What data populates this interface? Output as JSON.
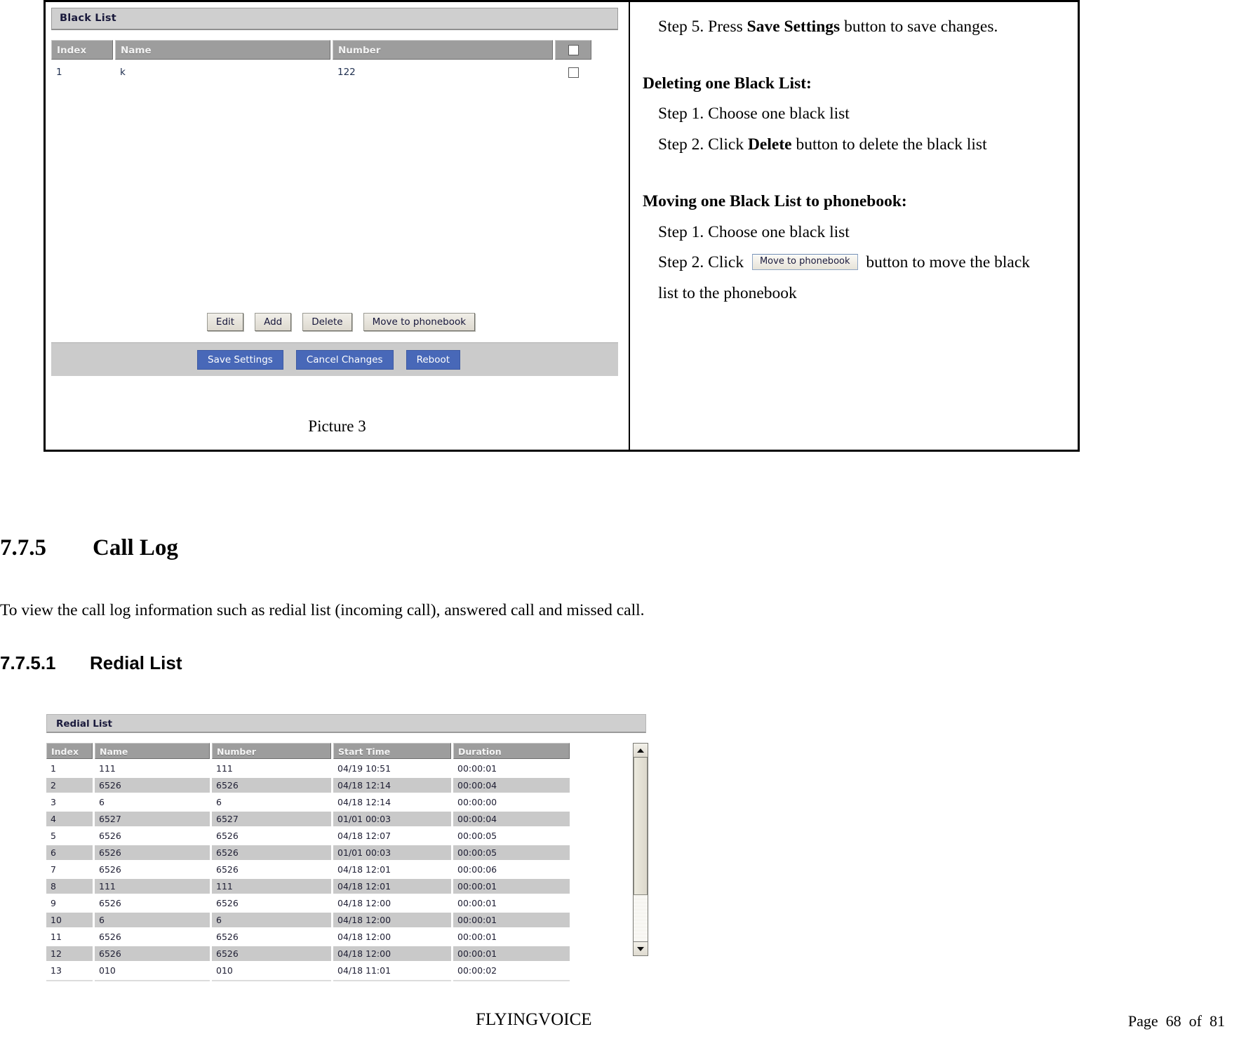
{
  "figure": {
    "caption": "Picture 3",
    "blacklist_panel": {
      "title": "Black List",
      "columns": [
        "Index",
        "Name",
        "Number"
      ],
      "select_all_checkbox": "select-all",
      "rows": [
        {
          "index": "1",
          "name": "k",
          "number": "122",
          "checked": false
        }
      ],
      "row_buttons": [
        "Edit",
        "Add",
        "Delete",
        "Move to phonebook"
      ],
      "footer_buttons": [
        "Save Settings",
        "Cancel Changes",
        "Reboot"
      ]
    },
    "instructions": {
      "step5_prefix": "Step 5. Press ",
      "step5_bold": "Save Settings",
      "step5_suffix": " button to save changes.",
      "delete_heading": "Deleting one Black List:",
      "delete_step1": "Step 1. Choose one black list",
      "delete_step2_prefix": "Step 2. Click ",
      "delete_step2_bold": "Delete",
      "delete_step2_suffix": " button to delete the black list",
      "move_heading": "Moving one Black List to phonebook:",
      "move_step1": "Step 1. Choose one black list",
      "move_step2_prefix": "Step 2. Click ",
      "move_step2_button": "Move to phonebook",
      "move_step2_suffix": " button to move the black",
      "move_step2_line2": "list to the phonebook"
    }
  },
  "document": {
    "section_number": "7.7.5",
    "section_title": "Call Log",
    "section_paragraph": "To view the call log information such as redial list (incoming call), answered call and missed call.",
    "subsection_number": "7.7.5.1",
    "subsection_title": "Redial List"
  },
  "redial_list": {
    "title": "Redial List",
    "columns": [
      "Index",
      "Name",
      "Number",
      "Start Time",
      "Duration"
    ],
    "rows": [
      {
        "index": "1",
        "name": "111",
        "number": "111",
        "start": "04/19 10:51",
        "duration": "00:00:01"
      },
      {
        "index": "2",
        "name": "6526",
        "number": "6526",
        "start": "04/18 12:14",
        "duration": "00:00:04"
      },
      {
        "index": "3",
        "name": "6",
        "number": "6",
        "start": "04/18 12:14",
        "duration": "00:00:00"
      },
      {
        "index": "4",
        "name": "6527",
        "number": "6527",
        "start": "01/01 00:03",
        "duration": "00:00:04"
      },
      {
        "index": "5",
        "name": "6526",
        "number": "6526",
        "start": "04/18 12:07",
        "duration": "00:00:05"
      },
      {
        "index": "6",
        "name": "6526",
        "number": "6526",
        "start": "01/01 00:03",
        "duration": "00:00:05"
      },
      {
        "index": "7",
        "name": "6526",
        "number": "6526",
        "start": "04/18 12:01",
        "duration": "00:00:06"
      },
      {
        "index": "8",
        "name": "111",
        "number": "111",
        "start": "04/18 12:01",
        "duration": "00:00:01"
      },
      {
        "index": "9",
        "name": "6526",
        "number": "6526",
        "start": "04/18 12:00",
        "duration": "00:00:01"
      },
      {
        "index": "10",
        "name": "6",
        "number": "6",
        "start": "04/18 12:00",
        "duration": "00:00:01"
      },
      {
        "index": "11",
        "name": "6526",
        "number": "6526",
        "start": "04/18 12:00",
        "duration": "00:00:01"
      },
      {
        "index": "12",
        "name": "6526",
        "number": "6526",
        "start": "04/18 12:00",
        "duration": "00:00:01"
      },
      {
        "index": "13",
        "name": "010",
        "number": "010",
        "start": "04/18 11:01",
        "duration": "00:00:02"
      }
    ],
    "scrollbar": {
      "up_arrow": "scroll-up-icon",
      "down_arrow": "scroll-down-icon"
    }
  },
  "footer": {
    "brand": "FLYINGVOICE",
    "page": "Page  68  of  81"
  },
  "colors": {
    "panel_header": "#cfcfcf",
    "table_header": "#9d9d9d",
    "primary_button": "#4868b8",
    "alt_row": "#c9c9c9"
  }
}
